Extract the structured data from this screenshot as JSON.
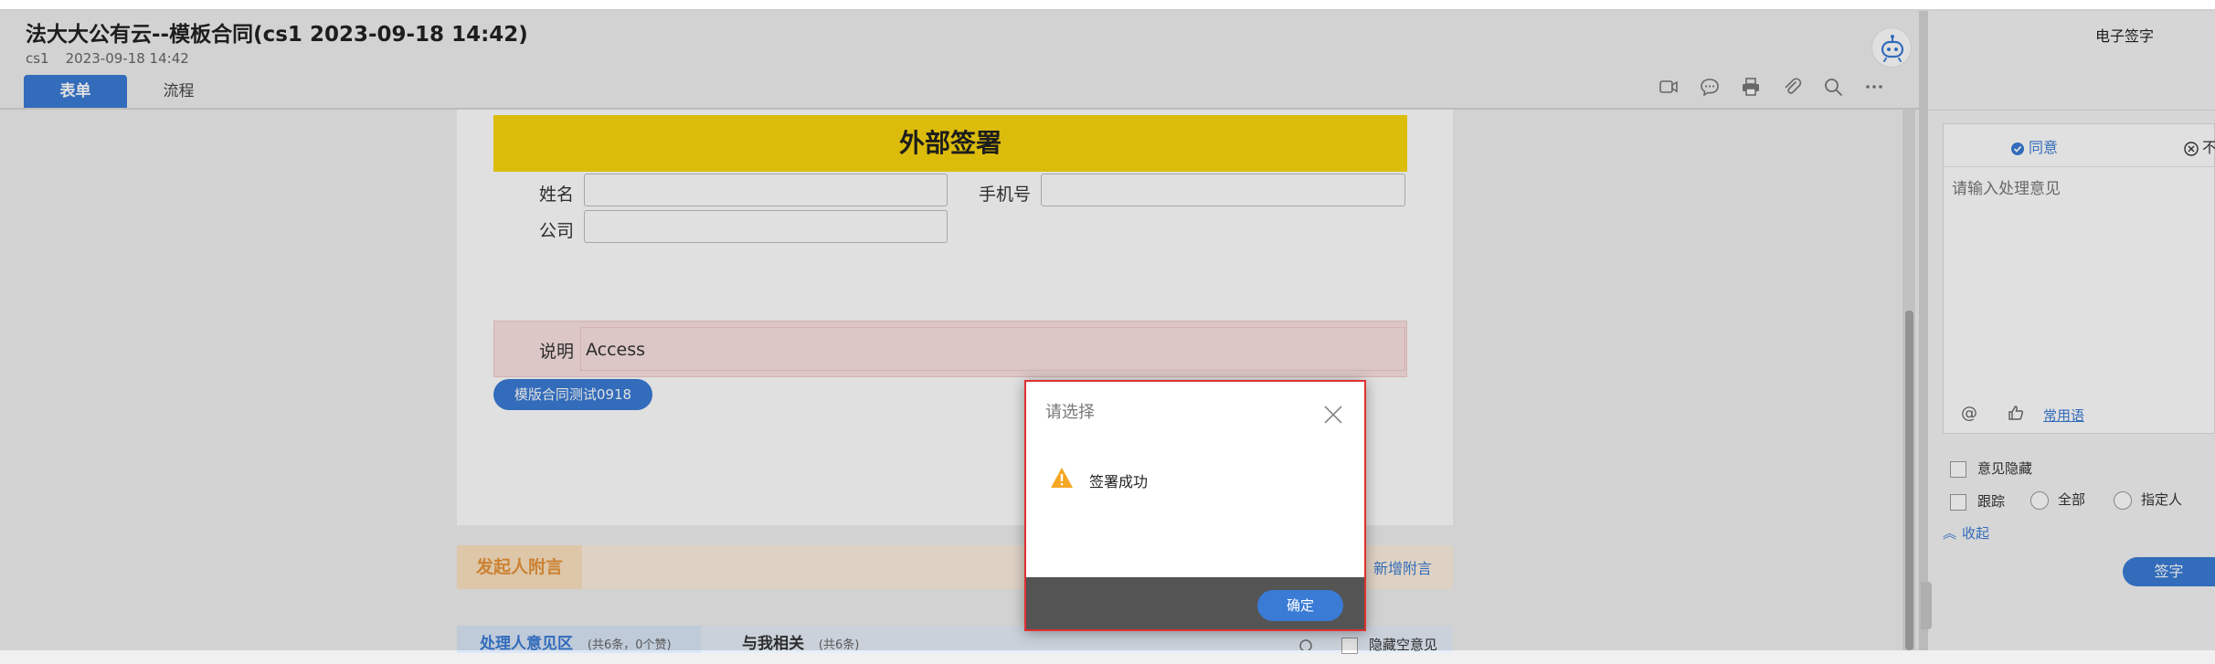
{
  "header": {
    "title": "法大大公有云--模板合同(cs1 2023-09-18 14:42)",
    "creator": "cs1",
    "created_at": "2023-09-18 14:42",
    "tabs": [
      {
        "label": "表单",
        "active": true
      },
      {
        "label": "流程",
        "active": false
      }
    ],
    "toolbar_icons": [
      "video-icon",
      "comment-icon",
      "print-icon",
      "attachment-icon",
      "search-icon",
      "more-icon"
    ]
  },
  "form": {
    "banner": "外部签署",
    "fields": {
      "name_label": "姓名",
      "phone_label": "手机号",
      "company_label": "公司",
      "desc_label": "说明",
      "desc_value": "Access"
    },
    "template_button": "模版合同测试0918"
  },
  "initiator": {
    "tab": "发起人附言",
    "new_note": "新增附言"
  },
  "opinions": {
    "handler_tab": "处理人意见区",
    "handler_count": "(共6条，0个赞)",
    "related_tab": "与我相关",
    "related_count": "(共6条)",
    "hide_empty": "隐藏空意见"
  },
  "right_panel": {
    "title": "电子签字",
    "agree": "同意",
    "disagree": "不",
    "placeholder": "请输入处理意见",
    "common_phrases": "常用语",
    "hide_opinion": "意见隐藏",
    "track": "跟踪",
    "all": "全部",
    "specify": "指定人",
    "collapse": "收起",
    "sign": "签字"
  },
  "dialog": {
    "title": "请选择",
    "message": "签署成功",
    "ok": "确定"
  },
  "colors": {
    "accent": "#3a7bd5",
    "banner": "#fbd70d",
    "warning": "#f5a623",
    "highlight_border": "#e03030"
  }
}
